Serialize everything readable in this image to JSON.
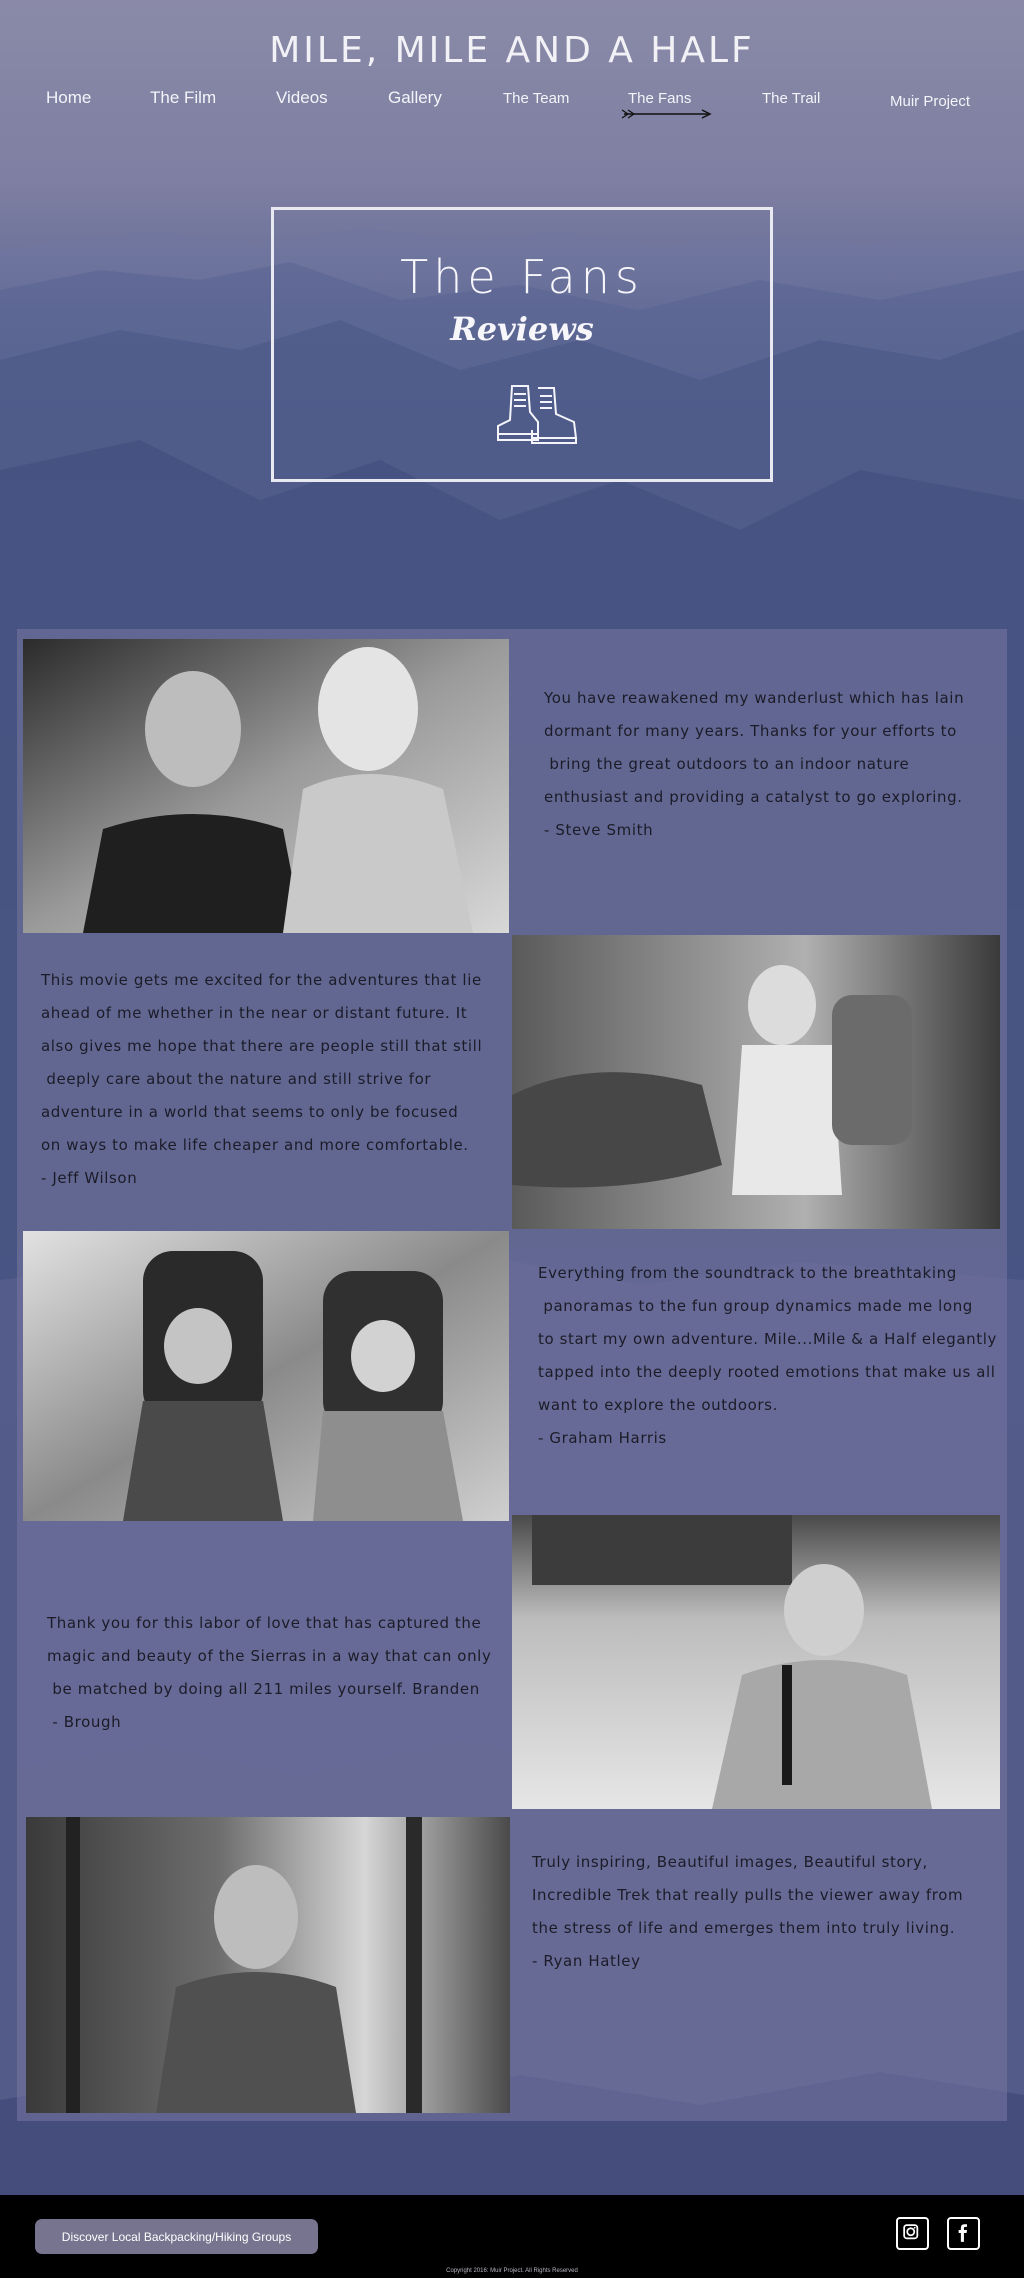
{
  "site": {
    "title": "MILE, MILE AND A HALF"
  },
  "nav": {
    "items": [
      {
        "label": "Home"
      },
      {
        "label": "The Film"
      },
      {
        "label": "Videos"
      },
      {
        "label": "Gallery"
      },
      {
        "label": "The Team"
      },
      {
        "label": "The Fans"
      },
      {
        "label": "The Trail"
      },
      {
        "label": "Muir Project"
      }
    ],
    "active": "The Fans"
  },
  "hero": {
    "title": "The Fans",
    "subtitle": "Reviews",
    "icon": "hiking-boots-icon"
  },
  "reviews": [
    {
      "text": "You have reawakened my wanderlust which has lain\ndormant for many years. Thanks for your efforts to\n bring the great outdoors to an indoor nature\nenthusiast and providing a catalyst to go exploring.\n- Steve Smith",
      "photo": "photo of two hikers smiling"
    },
    {
      "text": "This movie gets me excited for the adventures that lie\nahead of me whether in the near or distant future. It\nalso gives me hope that there are people still that still\n deeply care about the nature and still strive for\nadventure in a world that seems to only be focused\non ways to make life cheaper and more comfortable.\n- Jeff Wilson",
      "photo": "photo of bearded hiker with backpack"
    },
    {
      "text": "Everything from the soundtrack to the breathtaking\n panoramas to the fun group dynamics made me long\nto start my own adventure. Mile...Mile & a Half elegantly\ntapped into the deeply rooted emotions that make us all\nwant to explore the outdoors.\n- Graham Harris",
      "photo": "photo of two hikers with backpacks"
    },
    {
      "text": "Thank you for this labor of love that has captured the\nmagic and beauty of the Sierras in a way that can only\n be matched by doing all 211 miles yourself. Branden\n - Brough",
      "photo": "photo of man with camera strap"
    },
    {
      "text": "Truly inspiring, Beautiful images, Beautiful story,\nIncredible Trek that really pulls the viewer away from\nthe stress of life and emerges them into truly living.\n- Ryan Hatley",
      "photo": "photo of bearded man in forest"
    }
  ],
  "footer": {
    "discover_label": "Discover Local Backpacking/Hiking Groups",
    "social": [
      "instagram-icon",
      "facebook-icon"
    ],
    "copyright": "Copyright 2016: Muir Project. All Rights Reserved"
  },
  "colors": {
    "panel": "#7876a0",
    "button": "#77748f",
    "footer": "#000000"
  }
}
